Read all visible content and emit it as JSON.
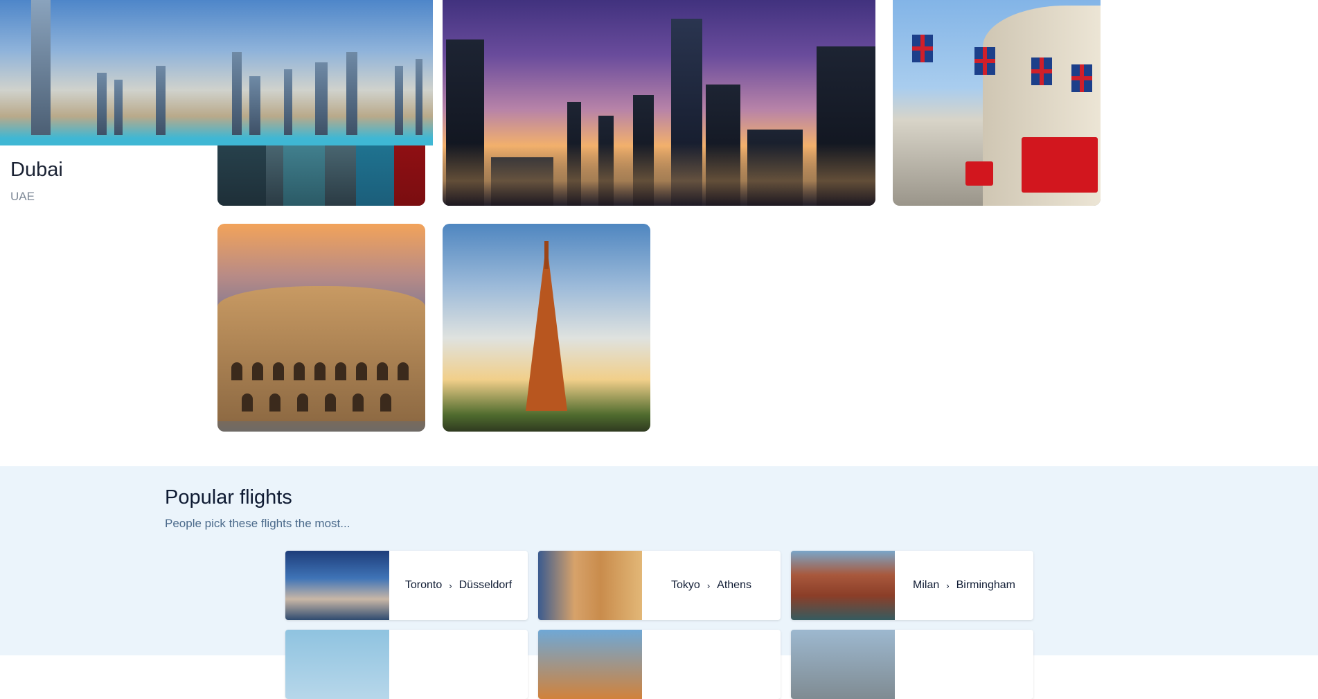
{
  "destinations": {
    "dubai": {
      "name": "Dubai",
      "country": "UAE"
    }
  },
  "popular_flights": {
    "title": "Popular flights",
    "subtitle": "People pick these flights the most...",
    "routes": [
      {
        "from": "Toronto",
        "to": "Düsseldorf"
      },
      {
        "from": "Tokyo",
        "to": "Athens"
      },
      {
        "from": "Milan",
        "to": "Birmingham"
      }
    ],
    "separator": "›"
  },
  "images": {
    "tokyo": "tokyo-street-image",
    "beijing": "beijing-skyline-image",
    "london": "london-regent-street-image",
    "rome": "colosseum-image",
    "paris": "eiffel-tower-image",
    "dubai": "dubai-skyline-image"
  }
}
